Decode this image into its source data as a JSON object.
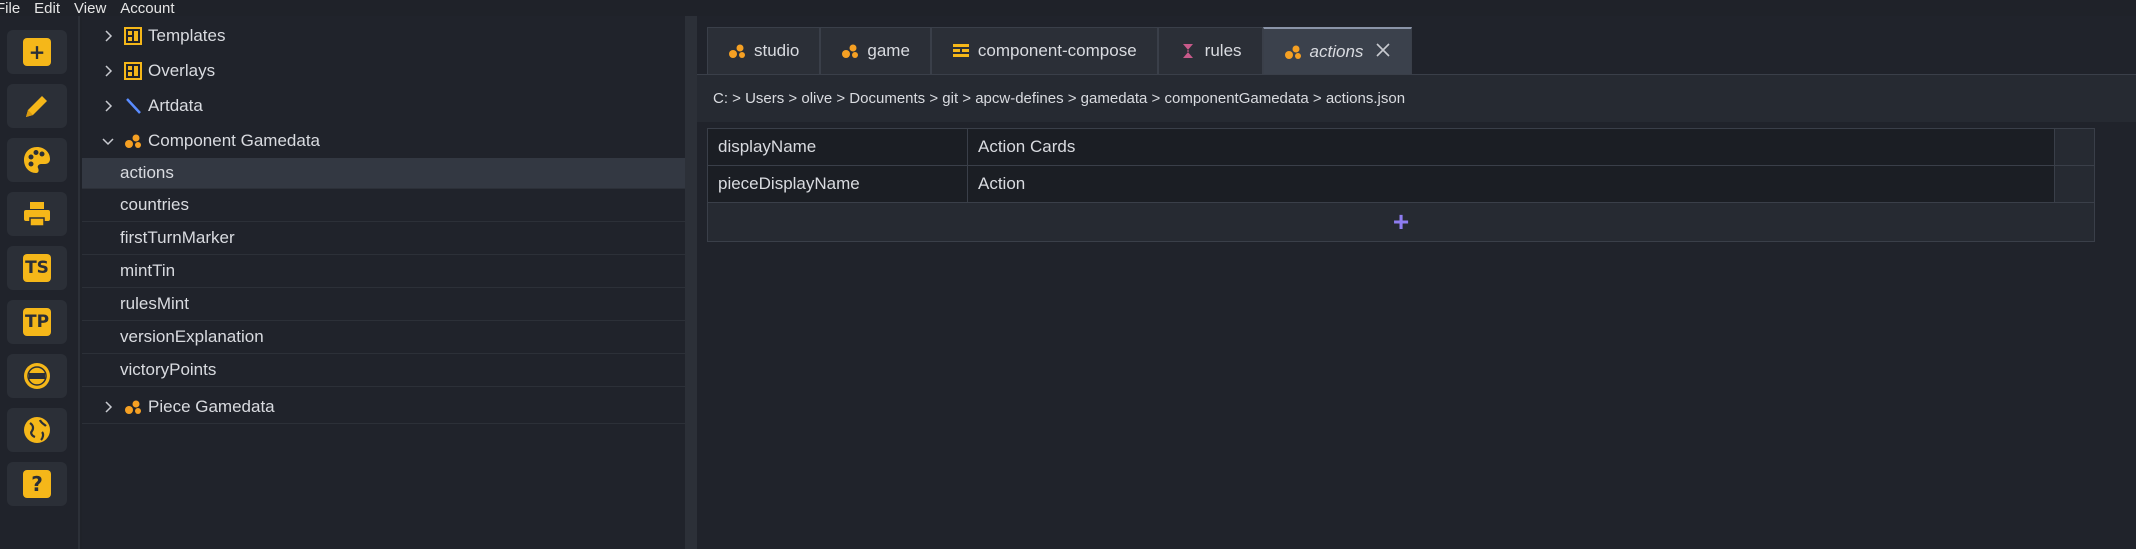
{
  "menu": {
    "file": "File",
    "edit": "Edit",
    "view": "View",
    "account": "Account"
  },
  "tree": {
    "items": [
      {
        "label": "Templates",
        "icon": "template-icon",
        "expandable": true,
        "expanded": false
      },
      {
        "label": "Overlays",
        "icon": "template-icon",
        "expandable": true,
        "expanded": false
      },
      {
        "label": "Artdata",
        "icon": "brush-icon",
        "expandable": true,
        "expanded": false
      },
      {
        "label": "Component Gamedata",
        "icon": "gamedata-icon",
        "expandable": true,
        "expanded": true
      },
      {
        "label": "actions",
        "selected": true
      },
      {
        "label": "countries"
      },
      {
        "label": "firstTurnMarker"
      },
      {
        "label": "mintTin"
      },
      {
        "label": "rulesMint"
      },
      {
        "label": "versionExplanation"
      },
      {
        "label": "victoryPoints"
      },
      {
        "label": "Piece Gamedata",
        "icon": "gamedata-icon",
        "expandable": true,
        "expanded": false
      }
    ]
  },
  "tabs": [
    {
      "label": "studio",
      "icon": "gamedata-icon"
    },
    {
      "label": "game",
      "icon": "gamedata-icon"
    },
    {
      "label": "component-compose",
      "icon": "compose-icon"
    },
    {
      "label": "rules",
      "icon": "rules-icon"
    },
    {
      "label": "actions",
      "icon": "gamedata-icon",
      "active": true
    }
  ],
  "breadcrumb": "C: > Users > olive > Documents > git > apcw-defines > gamedata > componentGamedata > actions.json",
  "rows": [
    {
      "key": "displayName",
      "value": "Action Cards"
    },
    {
      "key": "pieceDisplayName",
      "value": "Action"
    }
  ],
  "add_row_label": "+",
  "colors": {
    "accent_yellow": "#f5b719",
    "add_purple": "#8e7cf0",
    "background": "#20232b"
  }
}
